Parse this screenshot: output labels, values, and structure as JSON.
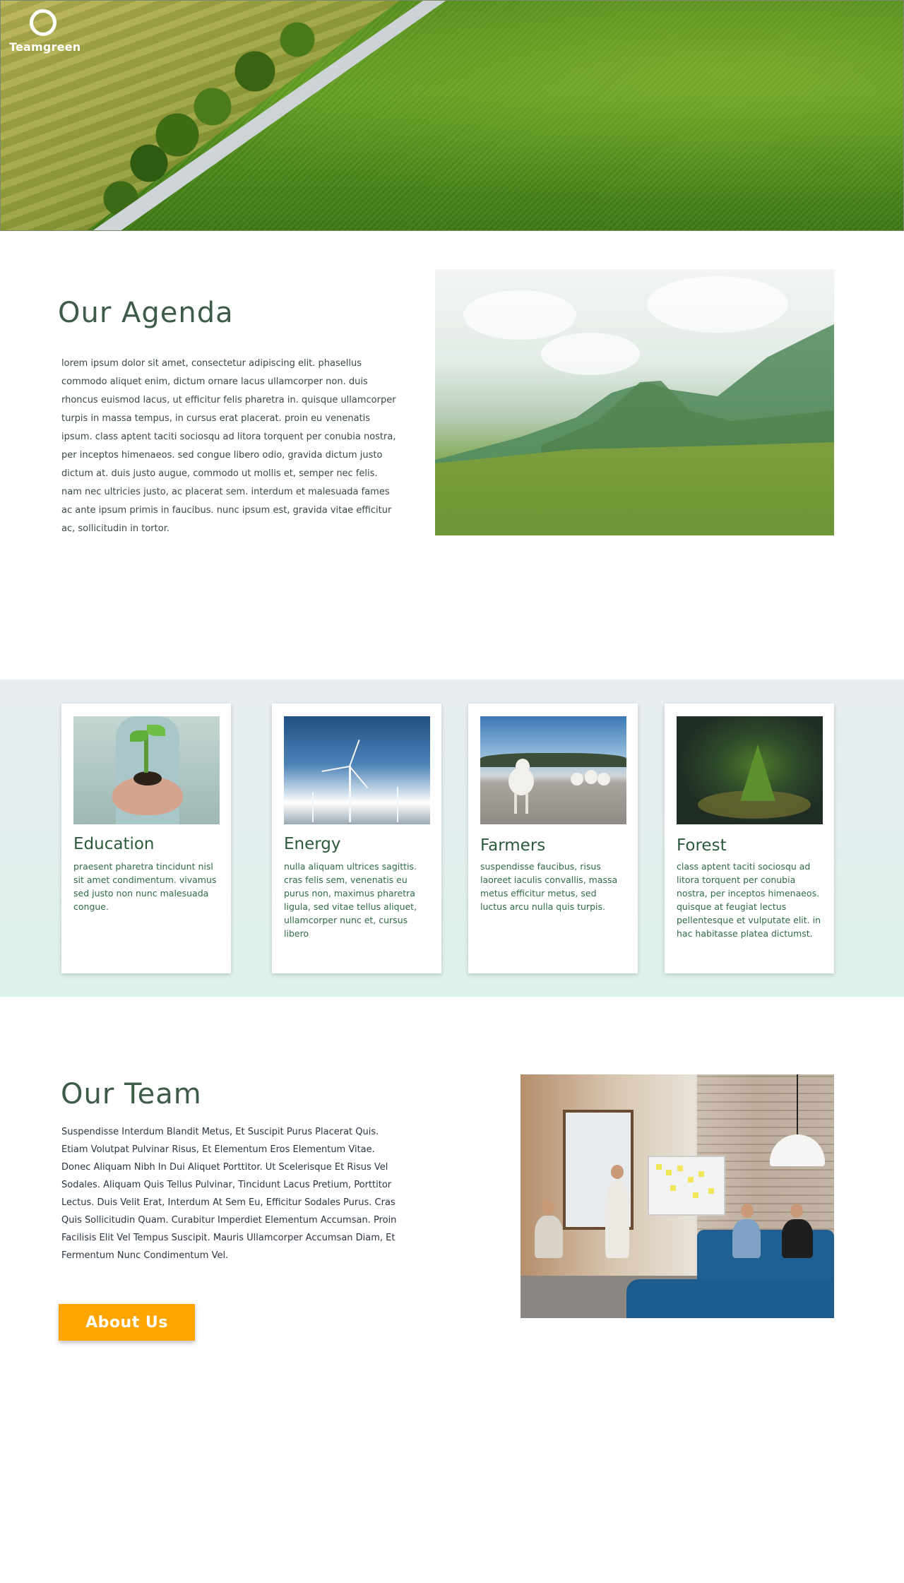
{
  "brand": {
    "logo_text": "Teamgreen"
  },
  "agenda": {
    "title": "Our Agenda",
    "body": "lorem ipsum dolor sit amet, consectetur adipiscing elit. phasellus commodo aliquet enim, dictum ornare lacus ullamcorper non. duis rhoncus euismod lacus, ut efficitur felis pharetra in. quisque ullamcorper turpis in massa tempus, in cursus erat placerat. proin eu venenatis ipsum. class aptent taciti sociosqu ad litora torquent per conubia nostra, per inceptos himenaeos. sed congue libero odio, gravida dictum justo dictum at. duis justo augue, commodo ut mollis et, semper nec felis. nam nec ultricies justo, ac placerat sem. interdum et malesuada fames ac ante ipsum primis in faucibus. nunc ipsum est, gravida vitae efficitur ac, sollicitudin in tortor."
  },
  "cards": [
    {
      "title": "Education",
      "text": "praesent pharetra tincidunt nisl sit amet condimentum. vivamus sed justo non nunc malesuada congue."
    },
    {
      "title": "Energy",
      "text": "nulla aliquam ultrices sagittis. cras felis sem, venenatis eu purus non, maximus pharetra ligula, sed vitae tellus aliquet, ullamcorper nunc et, cursus libero"
    },
    {
      "title": "Farmers",
      "text": "suspendisse faucibus, risus laoreet iaculis convallis, massa metus efficitur metus, sed luctus arcu nulla quis turpis."
    },
    {
      "title": "Forest",
      "text": "class aptent taciti sociosqu ad litora torquent per conubia nostra, per inceptos himenaeos. quisque at feugiat lectus pellentesque et vulputate elit. in hac habitasse platea dictumst."
    }
  ],
  "team": {
    "title": "Our Team",
    "body": "Suspendisse Interdum Blandit Metus, Et Suscipit Purus Placerat Quis. Etiam Volutpat Pulvinar Risus, Et Elementum Eros Elementum Vitae. Donec Aliquam Nibh In Dui Aliquet Porttitor. Ut Scelerisque Et Risus Vel Sodales. Aliquam Quis Tellus Pulvinar, Tincidunt Lacus Pretium, Porttitor Lectus. Duis Velit Erat, Interdum At Sem Eu, Efficitur Sodales Purus. Cras Quis Sollicitudin Quam. Curabitur Imperdiet Elementum Accumsan. Proin Facilisis Elit Vel Tempus Suscipit. Mauris Ullamcorper Accumsan Diam, Et Fermentum Nunc Condimentum Vel.",
    "button_label": "About Us"
  },
  "colors": {
    "accent": "#ffa500",
    "heading": "#3e5a48",
    "card_title": "#2c5a3a",
    "card_text": "#2e6a45"
  }
}
